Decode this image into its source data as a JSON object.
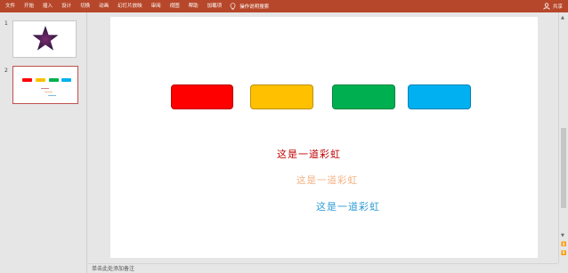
{
  "ribbon": {
    "tabs": [
      "文件",
      "开始",
      "插入",
      "设计",
      "切换",
      "动画",
      "幻灯片放映",
      "审阅",
      "视图",
      "帮助",
      "加载项"
    ],
    "tell_me": "操作说明搜索",
    "share": "共享",
    "color": "#b7472a"
  },
  "thumbnails": [
    {
      "number": "1"
    },
    {
      "number": "2"
    }
  ],
  "slide": {
    "shapes": [
      {
        "color": "#ff0000"
      },
      {
        "color": "#ffc000"
      },
      {
        "color": "#00b050"
      },
      {
        "color": "#00b0f0"
      }
    ],
    "texts": [
      {
        "text": "这是一道彩虹",
        "color": "#c00000"
      },
      {
        "text": "这是一道彩虹",
        "color": "#f4b183"
      },
      {
        "text": "这是一道彩虹",
        "color": "#2e9bd6"
      }
    ]
  },
  "scrollbar": {
    "up": "▲",
    "down": "▼",
    "prev": "⏫",
    "next": "⏬"
  },
  "notes": {
    "placeholder": "单击此处添加备注"
  }
}
